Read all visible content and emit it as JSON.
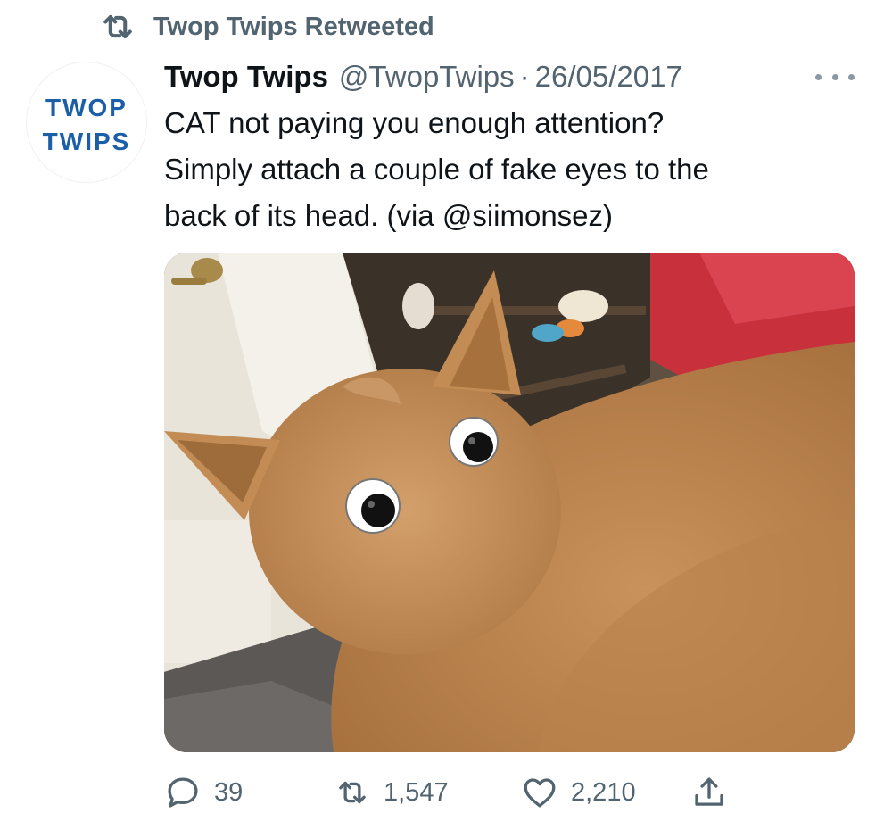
{
  "retweet": {
    "icon": "retweet-icon",
    "label": "Twop Twips Retweeted"
  },
  "author": {
    "avatar_text": [
      "TWOP",
      "TWIPS"
    ],
    "name": "Twop Twips",
    "handle": "@TwopTwips",
    "separator": "·",
    "date": "26/05/2017"
  },
  "tweet": {
    "lines": [
      "CAT not paying you enough attention?",
      "Simply attach a couple of fake eyes to the",
      "back of its head. (via @siimonsez)"
    ]
  },
  "media": {
    "description_icon": "cat-photo"
  },
  "actions": {
    "reply_count": "39",
    "retweet_count": "1,547",
    "like_count": "2,210"
  },
  "colors": {
    "text": "#0f1419",
    "muted": "#536471",
    "avatar_blue": "#1a5fa8"
  }
}
